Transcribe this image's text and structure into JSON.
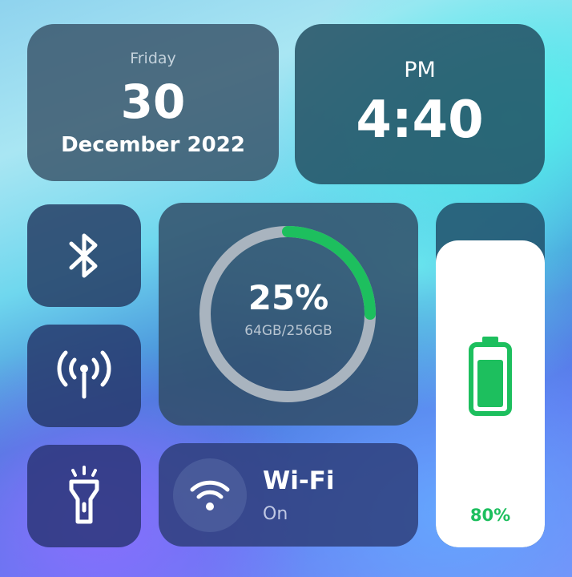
{
  "date_widget": {
    "weekday": "Friday",
    "day": "30",
    "month_year": "December 2022"
  },
  "clock_widget": {
    "ampm": "PM",
    "time": "4:40"
  },
  "toggles": {
    "bluetooth_icon": "bluetooth-icon",
    "cellular_icon": "cellular-signal-icon",
    "flashlight_icon": "flashlight-icon"
  },
  "storage_widget": {
    "percent_label": "25%",
    "capacity_label": "64GB/256GB",
    "used_fraction": 0.25,
    "ring_color": "#1dbf5e",
    "track_color": "#a9b4bf"
  },
  "wifi_widget": {
    "label": "Wi-Fi",
    "status": "On",
    "icon": "wifi-icon"
  },
  "battery_widget": {
    "percent_label": "80%",
    "level_fraction": 0.89,
    "icon": "battery-icon",
    "accent_color": "#1dbf5e"
  }
}
